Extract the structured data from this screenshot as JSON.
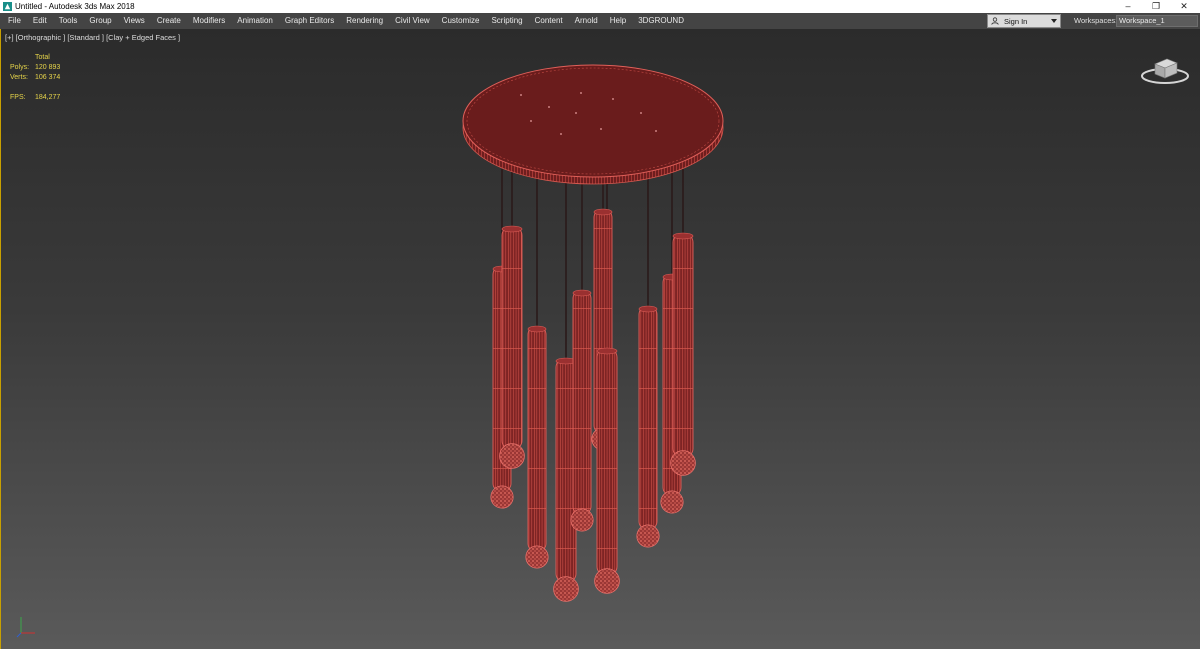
{
  "window": {
    "title": "Untitled - Autodesk 3ds Max 2018",
    "minimize_glyph": "–",
    "maximize_glyph": "❐",
    "close_glyph": "✕"
  },
  "menubar": {
    "items": [
      "File",
      "Edit",
      "Tools",
      "Group",
      "Views",
      "Create",
      "Modifiers",
      "Animation",
      "Graph Editors",
      "Rendering",
      "Civil View",
      "Customize",
      "Scripting",
      "Content",
      "Arnold",
      "Help",
      "3DGROUND"
    ],
    "sign_in": "Sign In",
    "workspaces_label": "Workspaces:",
    "workspace_value": "Workspace_1"
  },
  "viewport": {
    "label": "[+] [Orthographic ] [Standard ] [Clay + Edged Faces ]",
    "stats": {
      "header": "Total",
      "polys_label": "Polys:",
      "polys_value": "120 893",
      "verts_label": "Verts:",
      "verts_value": "106 374",
      "fps_label": "FPS:",
      "fps_value": "184,277"
    },
    "colors": {
      "model_fill": "#7e2424",
      "model_wire": "#e0605a",
      "cable": "#2a1a1a",
      "stats_text": "#e7d54a"
    }
  }
}
